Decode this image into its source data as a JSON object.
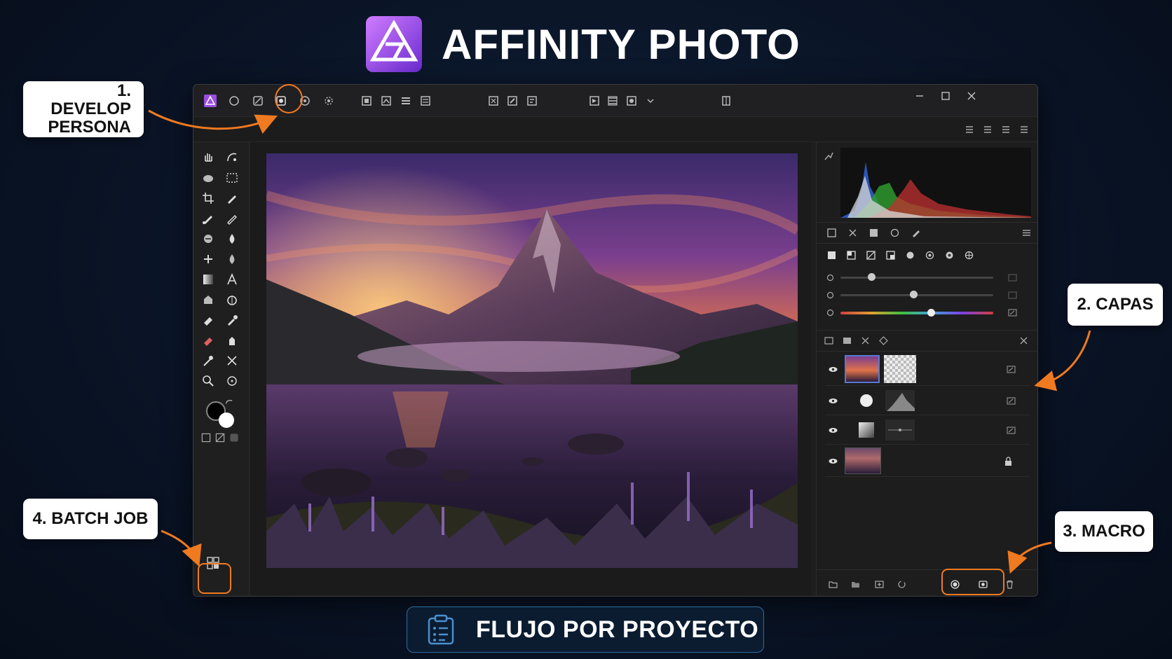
{
  "header": {
    "title": "AFFINITY PHOTO"
  },
  "callouts": {
    "develop": "1. DEVELOP PERSONA",
    "capas": "2. CAPAS",
    "macro": "3. MACRO",
    "batch": "4. BATCH JOB"
  },
  "footer": {
    "label": "FLUJO POR PROYECTO"
  },
  "colors": {
    "accent": "#f07a20",
    "brand": "#b15cf0",
    "background": "#0a1426",
    "footer_border": "#2e6da3"
  },
  "toolbar": {
    "icons": [
      "affinity-logo-icon",
      "photo-persona-icon",
      "liquify-persona-icon",
      "develop-persona-icon",
      "tone-mapping-persona-icon",
      "export-persona-icon",
      "snap-icon",
      "assistant-icon",
      "arrange-icon",
      "order-icon",
      "select-icon",
      "transform-icon",
      "align-icon",
      "adjust-icon",
      "distribute-icon",
      "view-icon",
      "chevron-down-icon",
      "studio-icon"
    ],
    "window_controls": [
      "minimize-icon",
      "maximize-icon",
      "close-icon"
    ]
  },
  "tools": [
    "hand-tool",
    "view-tool",
    "paint-mixer",
    "marquee",
    "crop",
    "pen",
    "brush",
    "pencil",
    "clone",
    "dodge",
    "healing",
    "burn",
    "gradient",
    "text",
    "fill",
    "blur",
    "eraser",
    "color-picker",
    "erase-brush",
    "smudge",
    "inpainting",
    "transform",
    "zoom",
    "sponge"
  ],
  "layers": {
    "rows": [
      "pixel-layer",
      "levels-adjustment",
      "curves-adjustment",
      "background-image"
    ]
  }
}
